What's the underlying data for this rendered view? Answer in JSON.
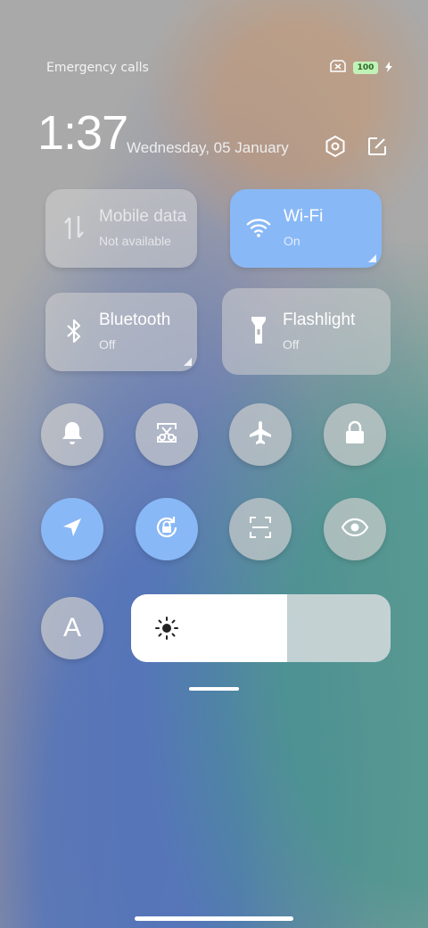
{
  "status_bar": {
    "left_text": "Emergency calls",
    "battery_level": "100",
    "icons": [
      "no-sim-icon",
      "battery-icon",
      "charging-bolt-icon"
    ]
  },
  "header": {
    "time": "1:37",
    "date": "Wednesday, 05 January",
    "icons": [
      "settings-icon",
      "edit-icon"
    ]
  },
  "big_tiles": [
    {
      "title": "Mobile data",
      "subtitle": "Not available",
      "icon": "mobile-data-icon",
      "state": "disabled"
    },
    {
      "title": "Wi-Fi",
      "subtitle": "On",
      "icon": "wifi-icon",
      "state": "on"
    },
    {
      "title": "Bluetooth",
      "subtitle": "Off",
      "icon": "bluetooth-icon",
      "state": "off"
    },
    {
      "title": "Flashlight",
      "subtitle": "Off",
      "icon": "flashlight-icon",
      "state": "off"
    }
  ],
  "toggles_row1": [
    {
      "icon": "bell-icon",
      "state": "off"
    },
    {
      "icon": "screenshot-icon",
      "state": "off"
    },
    {
      "icon": "airplane-icon",
      "state": "off"
    },
    {
      "icon": "lock-icon",
      "state": "off"
    }
  ],
  "toggles_row2": [
    {
      "icon": "location-icon",
      "state": "on"
    },
    {
      "icon": "rotation-lock-icon",
      "state": "on"
    },
    {
      "icon": "scanner-icon",
      "state": "off"
    },
    {
      "icon": "eye-icon",
      "state": "off"
    }
  ],
  "auto_brightness": {
    "label": "A",
    "icon": "auto-brightness-icon"
  },
  "brightness": {
    "level_percent": 60,
    "icon": "sun-icon"
  },
  "colors": {
    "accent": "#89b8f6",
    "tile": "#d2d2d2",
    "background": "#a9a9a9"
  }
}
